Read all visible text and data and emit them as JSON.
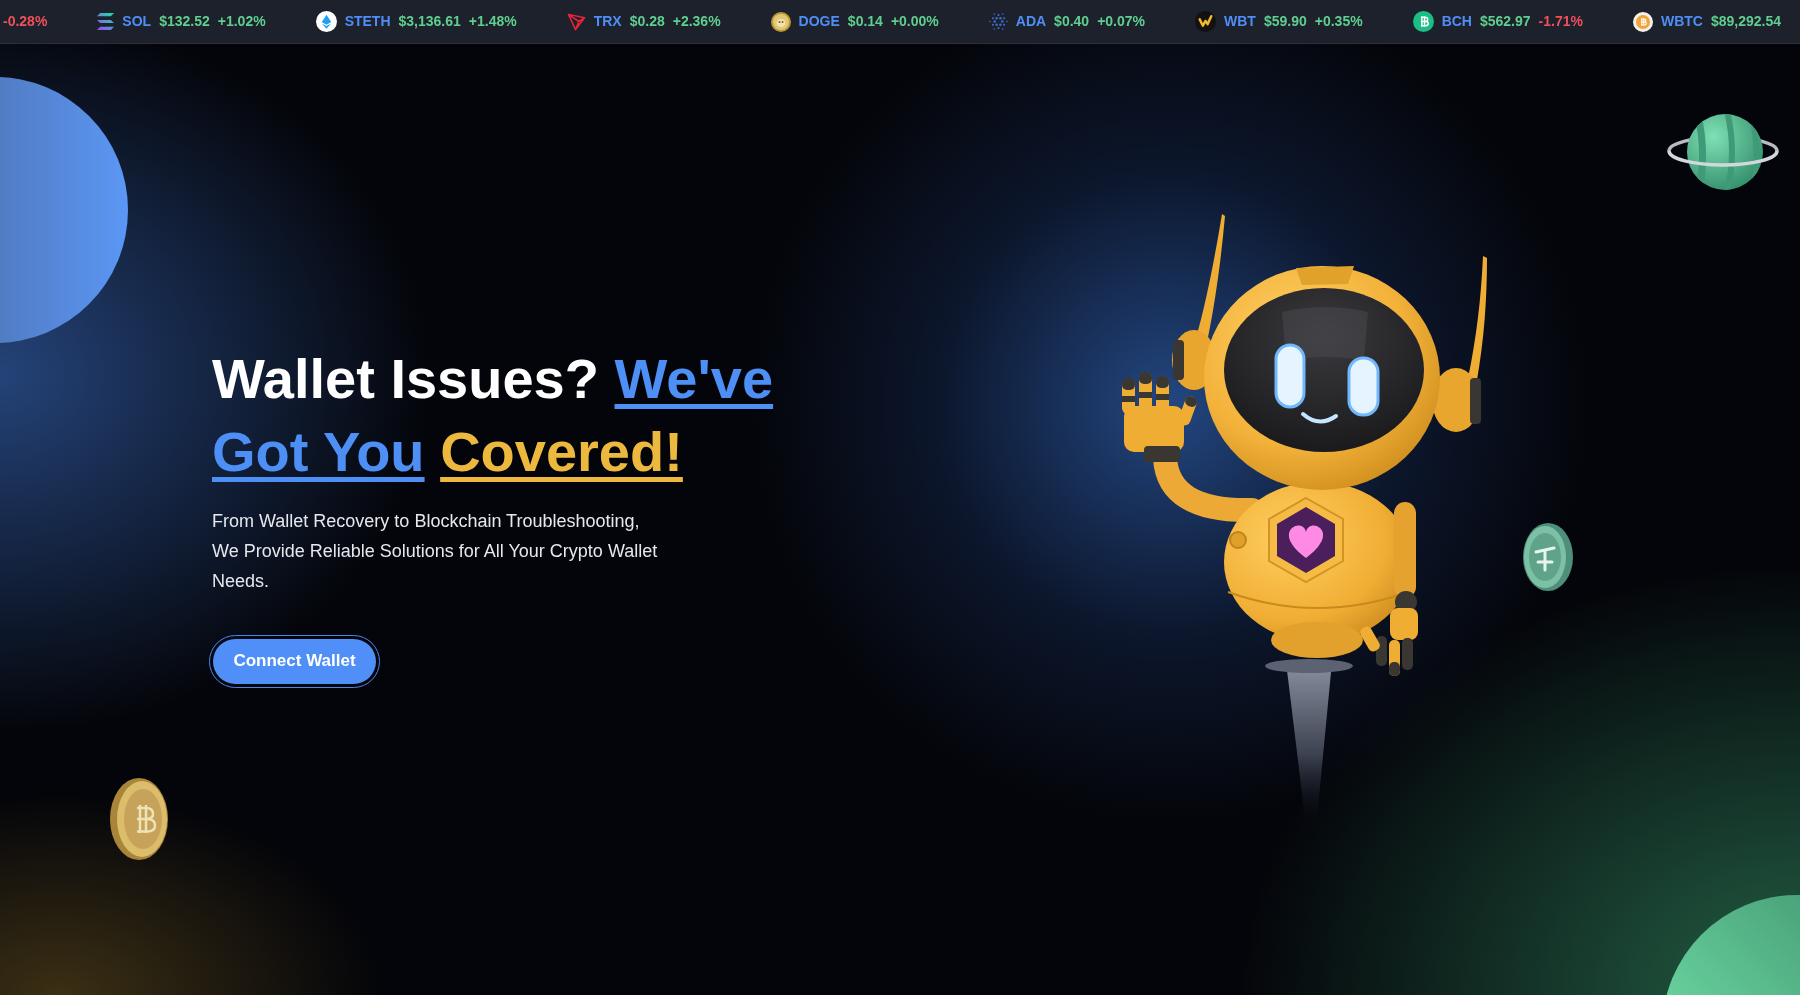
{
  "ticker": [
    {
      "change": "-0.28%",
      "negative": true
    },
    {
      "symbol": "SOL",
      "price": "$132.52",
      "change": "+1.02%",
      "negative": false
    },
    {
      "symbol": "STETH",
      "price": "$3,136.61",
      "change": "+1.48%",
      "negative": false
    },
    {
      "symbol": "TRX",
      "price": "$0.28",
      "change": "+2.36%",
      "negative": false
    },
    {
      "symbol": "DOGE",
      "price": "$0.14",
      "change": "+0.00%",
      "negative": false
    },
    {
      "symbol": "ADA",
      "price": "$0.40",
      "change": "+0.07%",
      "negative": false
    },
    {
      "symbol": "WBT",
      "price": "$59.90",
      "change": "+0.35%",
      "negative": false
    },
    {
      "symbol": "BCH",
      "price": "$562.97",
      "change": "-1.71%",
      "negative": true
    },
    {
      "symbol": "WBTC",
      "price": "$89,292.54"
    }
  ],
  "hero": {
    "heading": [
      {
        "text": "Wallet Issues?",
        "color": "#ffffff",
        "underlined": false
      },
      {
        "text": "We've Got You",
        "color": "#4d8ff5",
        "underlined": true
      },
      {
        "text": "Covered!",
        "color": "#ecb93e",
        "underlined": true
      }
    ],
    "description": [
      "From Wallet Recovery to Blockchain Troubleshooting,",
      "We Provide Reliable Solutions for All Your Crypto Wallet Needs."
    ],
    "button": "Connect Wallet"
  }
}
